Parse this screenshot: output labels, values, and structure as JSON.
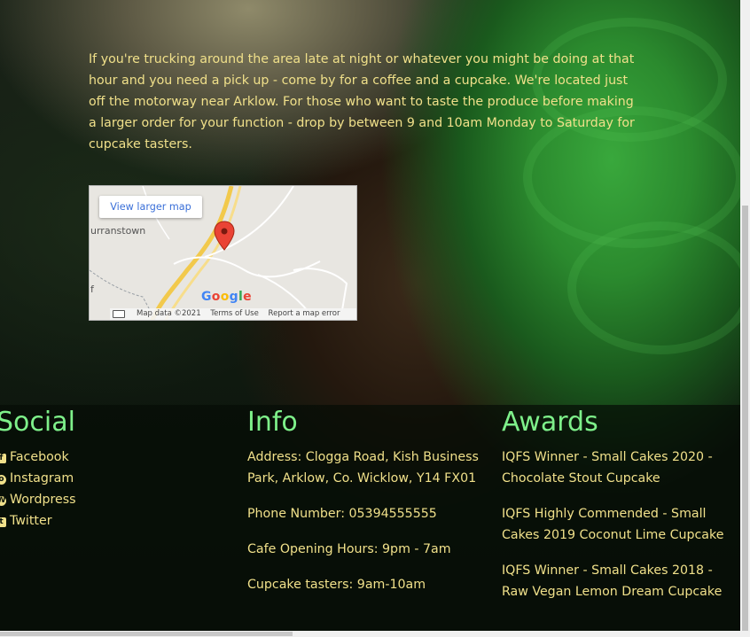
{
  "intro": {
    "text": "If you're trucking around the area late at night or whatever you might be doing at that hour and you need a pick up - come by for a coffee and a cupcake. We're located just off the motorway near Arklow. For those who want to taste the produce before making a larger order for your function - drop by between 9 and 10am Monday to Saturday for cupcake tasters."
  },
  "map": {
    "view_larger_label": "View larger map",
    "place_label": "urranstown",
    "edge_letter": "f",
    "google_logo": "Google",
    "map_data_label": "Map data ©2021",
    "terms_label": "Terms of Use",
    "report_label": "Report a map error",
    "keyboard_icon": "keyboard-icon",
    "pin_icon": "map-pin-icon"
  },
  "social": {
    "heading": "Social",
    "items": [
      {
        "label": "Facebook",
        "icon": "facebook-icon"
      },
      {
        "label": "Instagram",
        "icon": "instagram-icon"
      },
      {
        "label": "Wordpress",
        "icon": "wordpress-icon"
      },
      {
        "label": "Twitter",
        "icon": "twitter-icon"
      }
    ]
  },
  "info": {
    "heading": "Info",
    "address": "Address: Clogga Road, Kish Business Park, Arklow, Co. Wicklow, Y14 FX01",
    "phone": "Phone Number: 05394555555",
    "hours": "Cafe Opening Hours: 9pm - 7am",
    "tasters": "Cupcake tasters: 9am-10am"
  },
  "awards": {
    "heading": "Awards",
    "items": [
      "IQFS Winner - Small Cakes 2020 - Chocolate Stout Cupcake",
      "IQFS Highly Commended - Small Cakes 2019 Coconut Lime Cupcake",
      "IQFS Winner - Small Cakes 2018 - Raw Vegan Lemon Dream Cupcake"
    ]
  },
  "colors": {
    "text": "#f0e08a",
    "heading": "#7ef08a",
    "link": "#3a6fd8",
    "pin": "#ea4335"
  }
}
